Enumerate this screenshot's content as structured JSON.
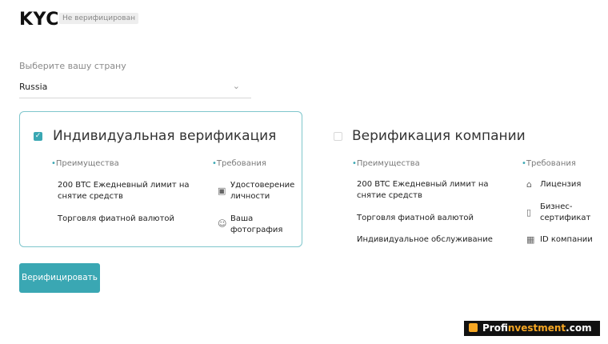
{
  "header": {
    "title": "KYC",
    "status_badge": "Не верифицирован"
  },
  "country": {
    "label": "Выберите вашу страну",
    "value": "Russia"
  },
  "options": {
    "individual": {
      "title": "Индивидуальная верификация",
      "checked": true,
      "benefits_title": "Преимущества",
      "benefits": [
        "200 BTC Ежедневный лимит на",
        "снятие средств",
        "Торговля фиатной валютой"
      ],
      "requirements_title": "Требования",
      "requirements": [
        {
          "icon": "id-card-icon",
          "lines": [
            "Удостоверение",
            "личности"
          ]
        },
        {
          "icon": "photo-icon",
          "lines": [
            "Ваша",
            "фотография"
          ]
        }
      ]
    },
    "company": {
      "title": "Верификация компании",
      "checked": false,
      "benefits_title": "Преимущества",
      "benefits": [
        "200 BTC Ежедневный лимит на",
        "снятие средств",
        "Торговля фиатной валютой",
        "Индивидуальное обслуживание"
      ],
      "requirements_title": "Требования",
      "requirements": [
        {
          "icon": "bank-icon",
          "lines": [
            "Лицензия"
          ]
        },
        {
          "icon": "certificate-icon",
          "lines": [
            "Бизнес-",
            "сертификат"
          ]
        },
        {
          "icon": "building-icon",
          "lines": [
            "ID компании"
          ]
        }
      ]
    }
  },
  "verify_button": "Верифицировать",
  "watermark": {
    "part1": "Prof",
    "part2": "investment",
    "part3": ".com"
  },
  "colors": {
    "accent": "#3aa7b3",
    "card_border": "#7fc6cc"
  }
}
